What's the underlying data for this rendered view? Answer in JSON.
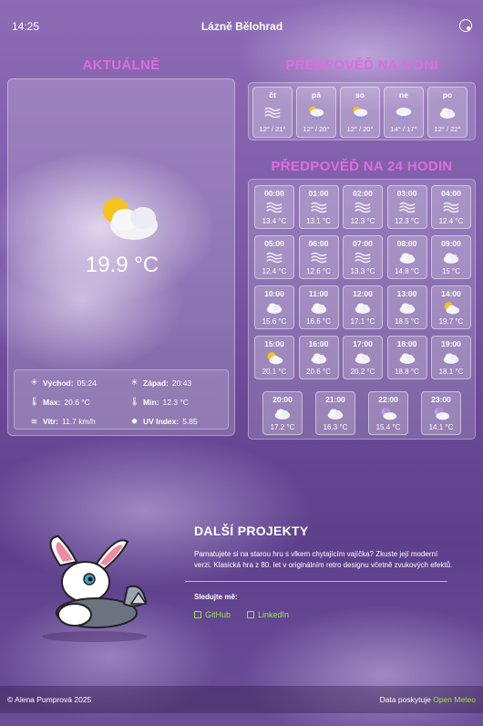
{
  "header": {
    "time": "14:25",
    "city": "Lázně Bělohrad"
  },
  "current": {
    "title": "AKTUÁLNĚ",
    "temperature": "19.9 °C",
    "details": [
      {
        "icon": "sunrise-icon",
        "label": "Východ:",
        "value": "05:24"
      },
      {
        "icon": "sunset-icon",
        "label": "Západ:",
        "value": "20:43"
      },
      {
        "icon": "thermometer-max-icon",
        "label": "Max:",
        "value": "20.6 °C"
      },
      {
        "icon": "thermometer-min-icon",
        "label": "Min:",
        "value": "12.3 °C"
      },
      {
        "icon": "wind-icon",
        "label": "Vítr:",
        "value": "11.7 km/h"
      },
      {
        "icon": "sun-uv-icon",
        "label": "UV Index:",
        "value": "5.85"
      }
    ]
  },
  "forecast5": {
    "title": "PŘEDPOVĚĎ NA 5 DNÍ",
    "days": [
      {
        "label": "čt",
        "icon": "fog",
        "range": "12° / 21°"
      },
      {
        "label": "pá",
        "icon": "sun-rain",
        "range": "12° / 20°"
      },
      {
        "label": "so",
        "icon": "sun-rain",
        "range": "12° / 20°"
      },
      {
        "label": "ne",
        "icon": "rain",
        "range": "14° / 17°"
      },
      {
        "label": "po",
        "icon": "cloud",
        "range": "12° / 22°"
      }
    ]
  },
  "forecast24": {
    "title": "PŘEDPOVĚĎ NA 24 HODIN",
    "hours": [
      {
        "label": "00:00",
        "icon": "fog",
        "temp": "13.4 °C"
      },
      {
        "label": "01:00",
        "icon": "fog",
        "temp": "13.1 °C"
      },
      {
        "label": "02:00",
        "icon": "fog",
        "temp": "12.3 °C"
      },
      {
        "label": "03:00",
        "icon": "fog",
        "temp": "12.3 °C"
      },
      {
        "label": "04:00",
        "icon": "fog",
        "temp": "12.4 °C"
      },
      {
        "label": "05:00",
        "icon": "fog",
        "temp": "12.4 °C"
      },
      {
        "label": "06:00",
        "icon": "fog",
        "temp": "12.6 °C"
      },
      {
        "label": "07:00",
        "icon": "fog",
        "temp": "13.3 °C"
      },
      {
        "label": "08:00",
        "icon": "cloud",
        "temp": "14.8 °C"
      },
      {
        "label": "09:00",
        "icon": "cloud",
        "temp": "15 °C"
      },
      {
        "label": "10:00",
        "icon": "cloud",
        "temp": "15.6 °C"
      },
      {
        "label": "11:00",
        "icon": "cloud",
        "temp": "16.6 °C"
      },
      {
        "label": "12:00",
        "icon": "cloud",
        "temp": "17.1 °C"
      },
      {
        "label": "13:00",
        "icon": "cloud",
        "temp": "18.5 °C"
      },
      {
        "label": "14:00",
        "icon": "sun-cloud",
        "temp": "19.7 °C"
      },
      {
        "label": "15:00",
        "icon": "sun-cloud",
        "temp": "20.1 °C"
      },
      {
        "label": "16:00",
        "icon": "cloud",
        "temp": "20.6 °C"
      },
      {
        "label": "17:00",
        "icon": "cloud",
        "temp": "20.2 °C"
      },
      {
        "label": "18:00",
        "icon": "cloud",
        "temp": "18.8 °C"
      },
      {
        "label": "19:00",
        "icon": "cloud",
        "temp": "18.1 °C"
      },
      {
        "label": "20:00",
        "icon": "cloud",
        "temp": "17.2 °C"
      },
      {
        "label": "21:00",
        "icon": "cloud",
        "temp": "16.3 °C"
      },
      {
        "label": "22:00",
        "icon": "moon-cloud",
        "temp": "15.4 °C"
      },
      {
        "label": "23:00",
        "icon": "moon-cloud",
        "temp": "14.1 °C"
      }
    ]
  },
  "projects": {
    "title": "DALŠÍ PROJEKTY",
    "text": "Pamatujete si na starou hru s vlkem chytajícím vajíčka? Zkuste její moderní verzi. Klasická hra z 80. let v originálním retro designu včetně zvukových efektů.",
    "follow": "Sledujte mě:",
    "links": [
      {
        "icon": "github-icon",
        "label": "GitHub"
      },
      {
        "icon": "linkedin-icon",
        "label": "LinkedIn"
      }
    ]
  },
  "footer": {
    "copyright": "© Alena Pumprová 2025",
    "provided": "Data poskytuje",
    "provider": "Open Meteo"
  },
  "colors": {
    "accent": "#e06be0",
    "link": "#9be34f"
  }
}
